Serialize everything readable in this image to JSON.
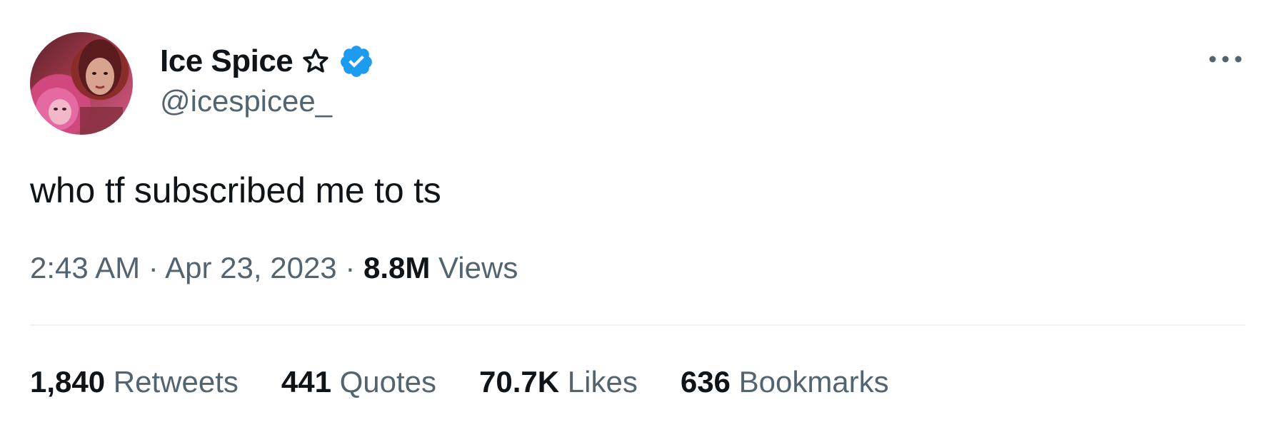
{
  "author": {
    "name": "Ice Spice",
    "handle": "@icespicee_",
    "star_icon": "star-outline-icon",
    "verified_icon": "verified-badge-icon",
    "verified_color": "#1d9bf0"
  },
  "tweet": {
    "text": "who tf subscribed me to ts",
    "time": "2:43 AM",
    "separator": "·",
    "date": "Apr 23, 2023",
    "views_count": "8.8M",
    "views_label": "Views"
  },
  "stats": [
    {
      "count": "1,840",
      "label": "Retweets"
    },
    {
      "count": "441",
      "label": "Quotes"
    },
    {
      "count": "70.7K",
      "label": "Likes"
    },
    {
      "count": "636",
      "label": "Bookmarks"
    }
  ],
  "more_icon": "more-horizontal-icon",
  "colors": {
    "text_primary": "#0f1419",
    "text_secondary": "#536471",
    "divider": "#eff3f4"
  }
}
